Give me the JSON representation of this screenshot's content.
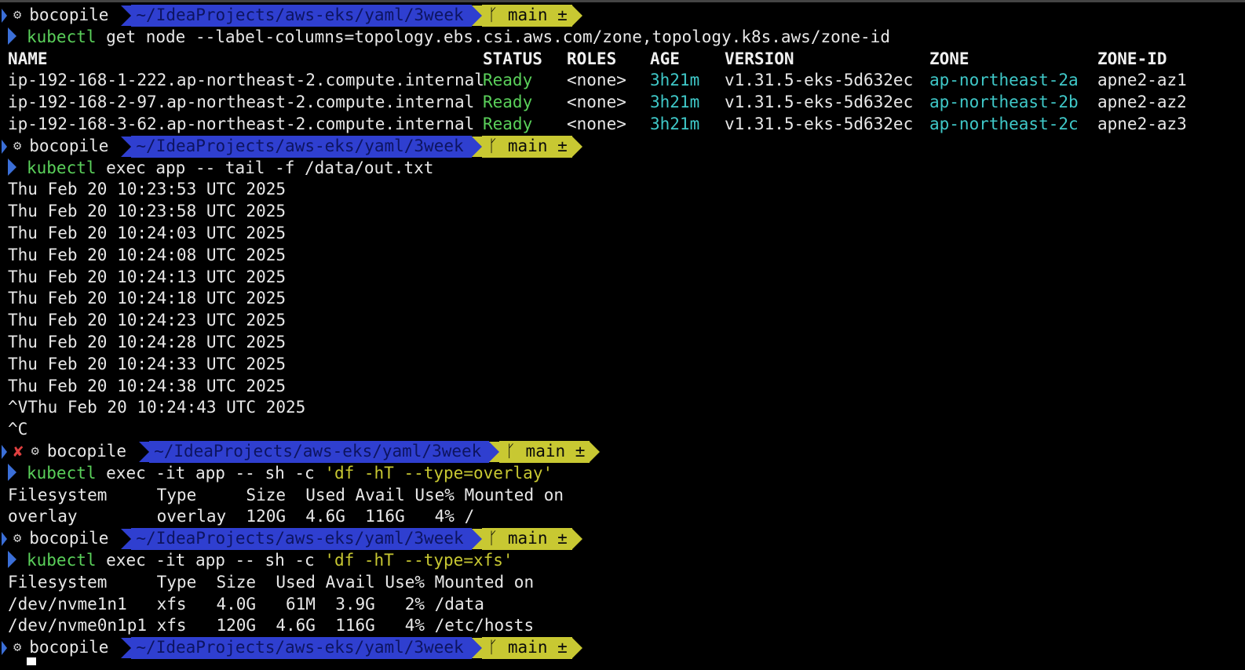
{
  "prompt": {
    "user": "bocopile",
    "path": "~/IdeaProjects/aws-eks/yaml/3week",
    "branch": "main ±",
    "error_mark": "✘"
  },
  "cmd1": {
    "bin": "kubectl",
    "args": " get node --label-columns=topology.ebs.csi.aws.com/zone,topology.k8s.aws/zone-id"
  },
  "nodes": {
    "headers": [
      "NAME",
      "STATUS",
      "ROLES",
      "AGE",
      "VERSION",
      "ZONE",
      "ZONE-ID"
    ],
    "rows": [
      [
        "ip-192-168-1-222.ap-northeast-2.compute.internal",
        "Ready",
        "<none>",
        "3h21m",
        "v1.31.5-eks-5d632ec",
        "ap-northeast-2a",
        "apne2-az1"
      ],
      [
        "ip-192-168-2-97.ap-northeast-2.compute.internal",
        "Ready",
        "<none>",
        "3h21m",
        "v1.31.5-eks-5d632ec",
        "ap-northeast-2b",
        "apne2-az2"
      ],
      [
        "ip-192-168-3-62.ap-northeast-2.compute.internal",
        "Ready",
        "<none>",
        "3h21m",
        "v1.31.5-eks-5d632ec",
        "ap-northeast-2c",
        "apne2-az3"
      ]
    ]
  },
  "cmd2": {
    "bin": "kubectl",
    "args": " exec app -- tail -f /data/out.txt"
  },
  "tail_output": [
    "Thu Feb 20 10:23:53 UTC 2025",
    "Thu Feb 20 10:23:58 UTC 2025",
    "Thu Feb 20 10:24:03 UTC 2025",
    "Thu Feb 20 10:24:08 UTC 2025",
    "Thu Feb 20 10:24:13 UTC 2025",
    "Thu Feb 20 10:24:18 UTC 2025",
    "Thu Feb 20 10:24:23 UTC 2025",
    "Thu Feb 20 10:24:28 UTC 2025",
    "Thu Feb 20 10:24:33 UTC 2025",
    "Thu Feb 20 10:24:38 UTC 2025",
    "^VThu Feb 20 10:24:43 UTC 2025",
    "^C"
  ],
  "cmd3": {
    "bin": "kubectl",
    "args": " exec -it app -- sh -c ",
    "str": "'df -hT --type=overlay'"
  },
  "df_overlay": [
    "Filesystem     Type     Size  Used Avail Use% Mounted on",
    "overlay        overlay  120G  4.6G  116G   4% /"
  ],
  "cmd4": {
    "bin": "kubectl",
    "args": " exec -it app -- sh -c ",
    "str": "'df -hT --type=xfs'"
  },
  "df_xfs": [
    "Filesystem     Type  Size  Used Avail Use% Mounted on",
    "/dev/nvme1n1   xfs   4.0G   61M  3.9G   2% /data",
    "/dev/nvme0n1p1 xfs   120G  4.6G  116G   4% /etc/hosts"
  ],
  "colors": {
    "path_bg": "#2f3fd0",
    "git_bg": "#c8c832",
    "command": "#5ad05a",
    "cyan": "#3fc8c8"
  }
}
